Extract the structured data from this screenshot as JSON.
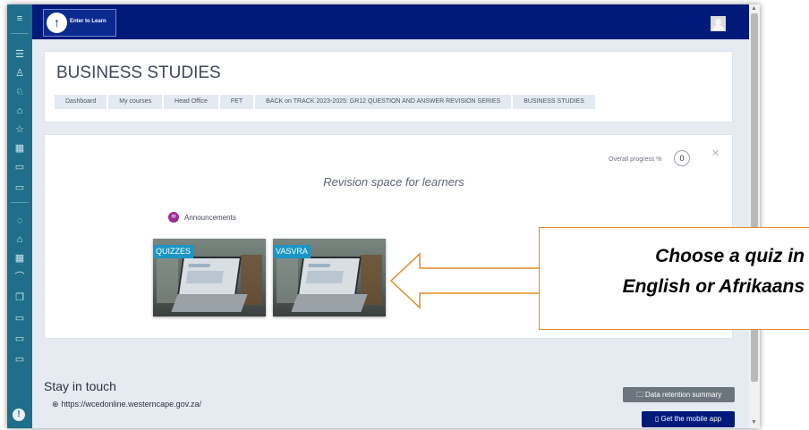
{
  "navbar": {
    "logo_text": "Enter to Learn",
    "logo_glyph": "↑",
    "bg_color": "#001a7a"
  },
  "sidebar": {
    "bg_color": "#1f6f8a",
    "icons": [
      {
        "name": "menu-icon",
        "glyph": "≡"
      },
      {
        "name": "list-icon",
        "glyph": "☰"
      },
      {
        "name": "badge-icon",
        "glyph": "♙"
      },
      {
        "name": "award-icon",
        "glyph": "♘"
      },
      {
        "name": "dashboard-icon",
        "glyph": "⌂"
      },
      {
        "name": "star-icon",
        "glyph": "☆"
      },
      {
        "name": "calendar-icon",
        "glyph": "▦"
      },
      {
        "name": "folder-icon",
        "glyph": "▭"
      },
      {
        "name": "folder-icon-2",
        "glyph": "▭"
      },
      {
        "name": "course-icon",
        "glyph": "◌"
      },
      {
        "name": "home-icon",
        "glyph": "⌂"
      },
      {
        "name": "calendar-icon-2",
        "glyph": "▦"
      },
      {
        "name": "graduation-icon",
        "glyph": "⌒"
      },
      {
        "name": "files-icon",
        "glyph": "❐"
      },
      {
        "name": "folder-icon-3",
        "glyph": "▭"
      },
      {
        "name": "folder-icon-4",
        "glyph": "▭"
      },
      {
        "name": "folder-icon-5",
        "glyph": "▭"
      }
    ],
    "bottom_glyph": "!"
  },
  "header": {
    "title": "BUSINESS STUDIES",
    "breadcrumbs": [
      "Dashboard",
      "My courses",
      "Head Office",
      "FET",
      "BACK on TRACK 2023-2025: GR12 QUESTION AND ANSWER REVISION SERIES",
      "BUSINESS STUDIES"
    ]
  },
  "course": {
    "close_glyph": "✕",
    "progress_label": "Overall progress %",
    "progress_value": "0",
    "summary": "Revision space for learners",
    "announcements_label": "Announcements",
    "announcements_glyph": "✉",
    "tiles": [
      {
        "label": "QUIZZES"
      },
      {
        "label": "VASVRA"
      }
    ]
  },
  "callout": {
    "line1": "Choose a quiz in",
    "line2": "English or Afrikaans",
    "border_color": "#e48a2c"
  },
  "footer": {
    "title": "Stay in touch",
    "link_glyph": "⊕",
    "link": "https://wcedonline.westerncape.gov.za/",
    "retention_button": "🗀 Data retention summary",
    "mobile_button": "▯ Get the mobile app"
  }
}
